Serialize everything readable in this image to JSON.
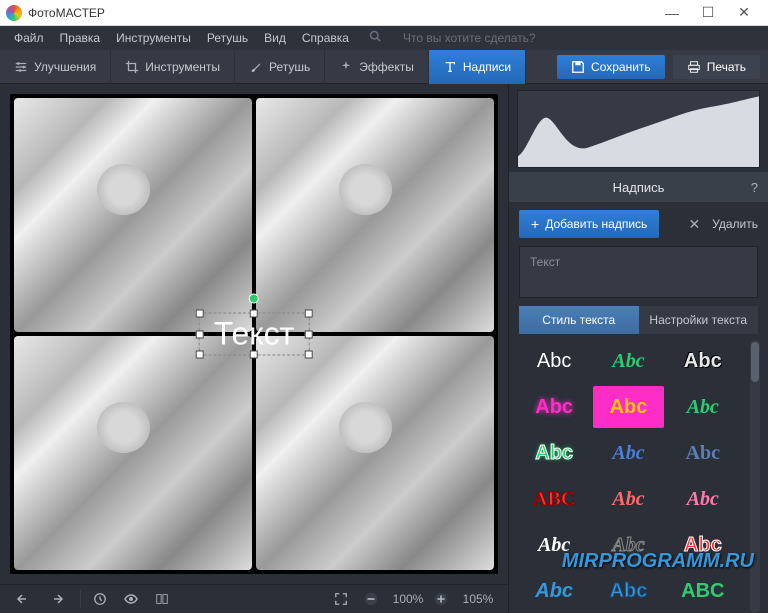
{
  "window": {
    "title": "ФотоМАСТЕР"
  },
  "menu": {
    "file": "Файл",
    "edit": "Правка",
    "tools": "Инструменты",
    "retouch": "Ретушь",
    "view": "Вид",
    "help": "Справка",
    "search_placeholder": "Что вы хотите сделать?"
  },
  "toolbar": {
    "enhance": "Улучшения",
    "tools": "Инструменты",
    "retouch": "Ретушь",
    "effects": "Эффекты",
    "captions": "Надписи",
    "save": "Сохранить",
    "print": "Печать"
  },
  "canvas": {
    "overlay_text": "Текст"
  },
  "bottombar": {
    "zoom1": "100%",
    "zoom2": "105%"
  },
  "sidepanel": {
    "section_title": "Надпись",
    "add_caption": "Добавить надпись",
    "delete": "Удалить",
    "text_placeholder": "Текст",
    "tab_style": "Стиль текста",
    "tab_settings": "Настройки текста",
    "style_samples": [
      "Abc",
      "Abc",
      "Abc",
      "Abc",
      "Abc",
      "Abc",
      "Abc",
      "Abc",
      "Abc",
      "ABC",
      "Abc",
      "Abc",
      "Abc",
      "Abc",
      "Abc",
      "Abc",
      "Abc",
      "ABC"
    ]
  },
  "watermark": "MIRPROGRAMM.RU"
}
